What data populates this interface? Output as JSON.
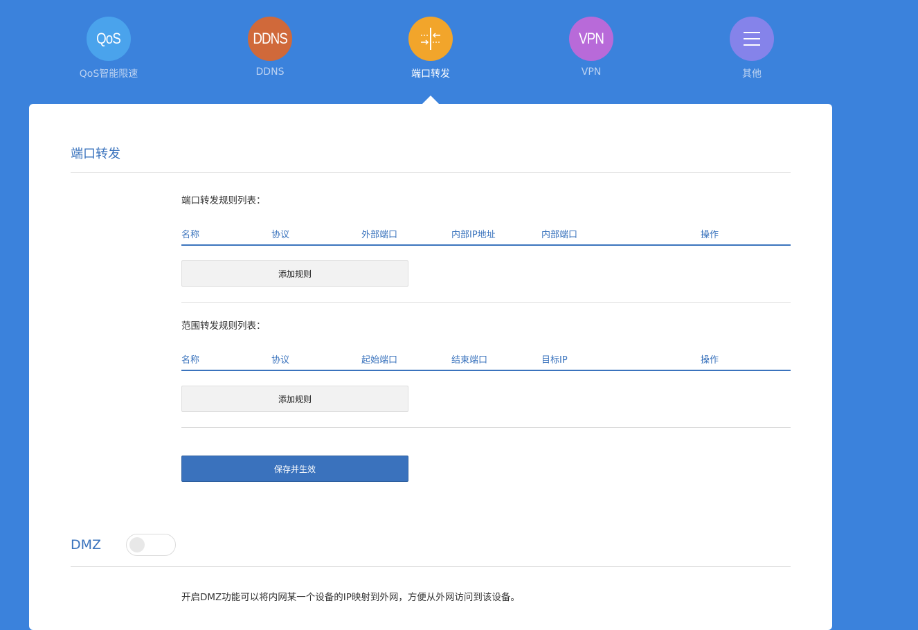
{
  "nav": {
    "items": [
      {
        "label": "QoS智能限速",
        "icon_text": "QoS",
        "color": "#4aa3ec"
      },
      {
        "label": "DDNS",
        "icon_text": "DDNS",
        "color": "#d0693a"
      },
      {
        "label": "端口转发",
        "icon": "port-forward-icon",
        "color": "#f2a52b",
        "active": true
      },
      {
        "label": "VPN",
        "icon_text": "VPN",
        "color": "#b86ad9"
      },
      {
        "label": "其他",
        "icon": "menu-icon",
        "color": "#8583ea"
      }
    ]
  },
  "port_forward": {
    "title": "端口转发",
    "rules_title": "端口转发规则列表：",
    "rules_headers": [
      "名称",
      "协议",
      "外部端口",
      "内部IP地址",
      "内部端口",
      "操作"
    ],
    "add_rule_label": "添加规则",
    "range_title": "范围转发规则列表：",
    "range_headers": [
      "名称",
      "协议",
      "起始端口",
      "结束端口",
      "目标IP",
      "操作"
    ],
    "add_range_label": "添加规则",
    "save_label": "保存并生效"
  },
  "dmz": {
    "title": "DMZ",
    "enabled": false,
    "description": "开启DMZ功能可以将内网某一个设备的IP映射到外网，方便从外网访问到该设备。"
  },
  "colors": {
    "background": "#3b82dc",
    "accent": "#3a73bd"
  }
}
